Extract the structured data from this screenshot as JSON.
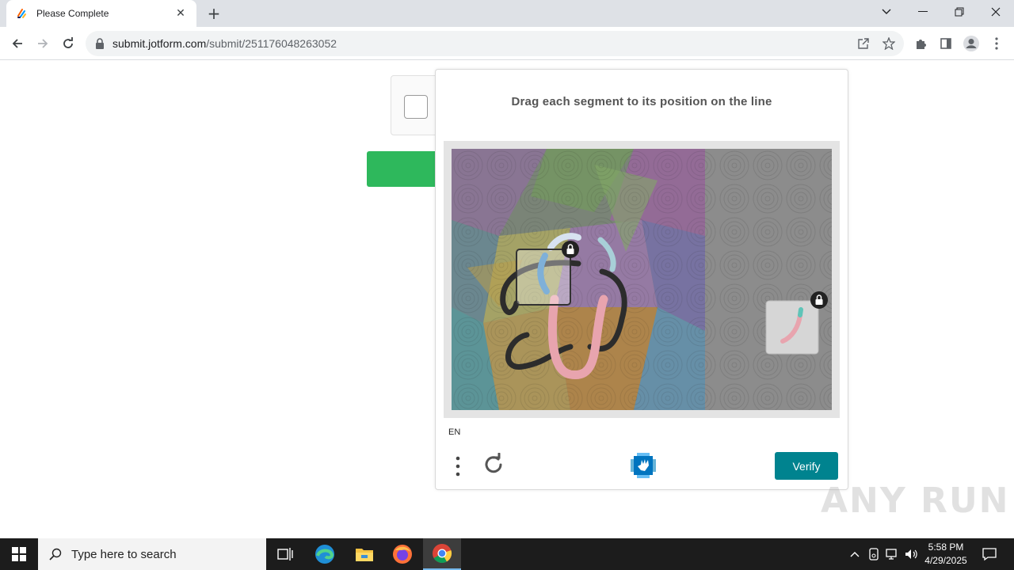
{
  "browser": {
    "tab_title": "Please Complete",
    "url_host": "submit.jotform.com",
    "url_path": "/submit/251176048263052"
  },
  "captcha": {
    "prompt": "Drag each segment to its position on the line",
    "language": "EN",
    "verify_label": "Verify"
  },
  "watermark": "ANY RUN",
  "taskbar": {
    "search_placeholder": "Type here to search",
    "time": "5:58 PM",
    "date": "4/29/2025"
  },
  "colors": {
    "verify": "#00838f",
    "submit_green": "#2eb85c"
  }
}
